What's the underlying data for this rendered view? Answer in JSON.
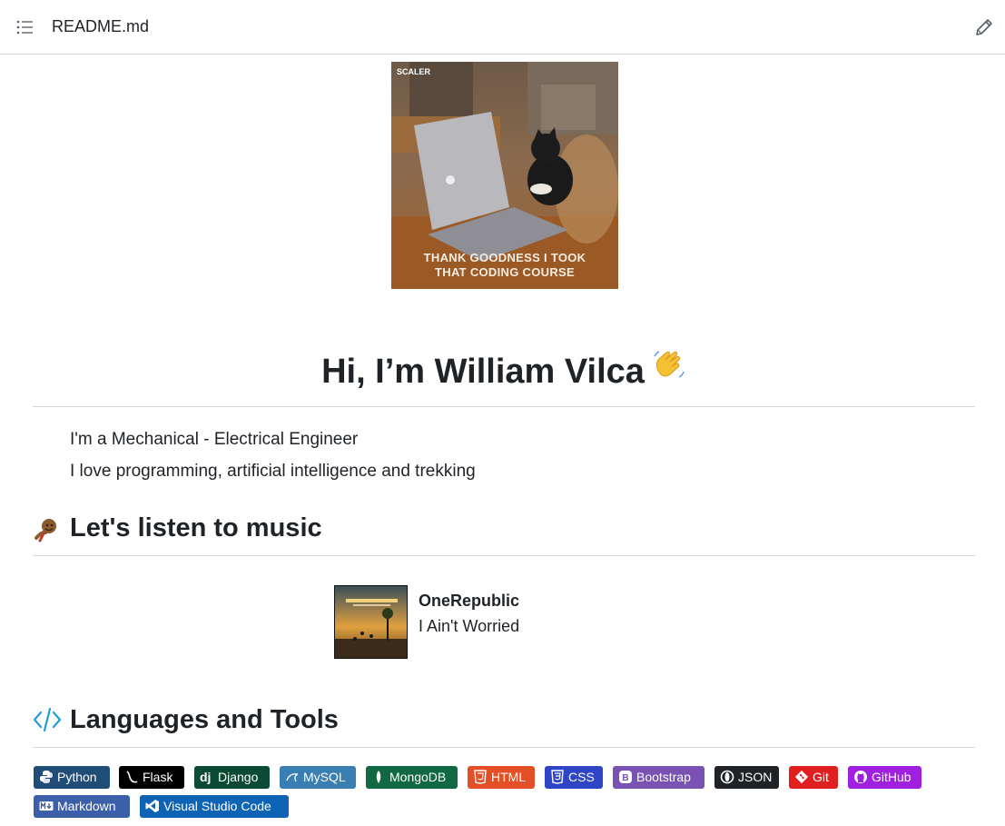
{
  "header": {
    "file_name": "README.md",
    "toc_icon": "list-unordered-icon",
    "edit_icon": "pencil-icon"
  },
  "hero": {
    "caption_line1": "THANK GOODNESS I TOOK",
    "caption_line2": "THAT CODING COURSE",
    "brand": "SCALER"
  },
  "intro": {
    "title": "Hi, I’m William Vilca",
    "title_emoji_icon": "waving-hand-icon",
    "line1": "I'm a Mechanical - Electrical Engineer",
    "line2": "I love programming, artificial intelligence and trekking"
  },
  "music": {
    "heading": "Let's listen to music",
    "heading_icon": "dancing-emoji-icon",
    "artist": "OneRepublic",
    "song": "I Ain't Worried"
  },
  "tools": {
    "heading": "Languages and Tools",
    "heading_icon": "code-icon",
    "badges": [
      {
        "label": "Python",
        "color": "#1f4d78",
        "icon": "python-icon"
      },
      {
        "label": "Flask",
        "color": "#000000",
        "icon": "flask-icon"
      },
      {
        "label": "Django",
        "color": "#0c4b33",
        "icon": "django-icon"
      },
      {
        "label": "MySQL",
        "color": "#3a7fb3",
        "icon": "mysql-icon"
      },
      {
        "label": "MongoDB",
        "color": "#106943",
        "icon": "mongodb-icon"
      },
      {
        "label": "HTML",
        "color": "#e34f26",
        "icon": "html5-icon"
      },
      {
        "label": "CSS",
        "color": "#2f45c7",
        "icon": "css3-icon"
      },
      {
        "label": "Bootstrap",
        "color": "#7952b3",
        "icon": "bootstrap-icon"
      },
      {
        "label": "JSON",
        "color": "#1f2328",
        "icon": "json-icon"
      },
      {
        "label": "Git",
        "color": "#e11f1f",
        "icon": "git-icon"
      },
      {
        "label": "GitHub",
        "color": "#a020e0",
        "icon": "github-icon"
      },
      {
        "label": "Markdown",
        "color": "#3b5fa8",
        "icon": "markdown-icon"
      },
      {
        "label": "Visual Studio Code",
        "color": "#0f63b5",
        "icon": "vscode-icon"
      }
    ]
  }
}
